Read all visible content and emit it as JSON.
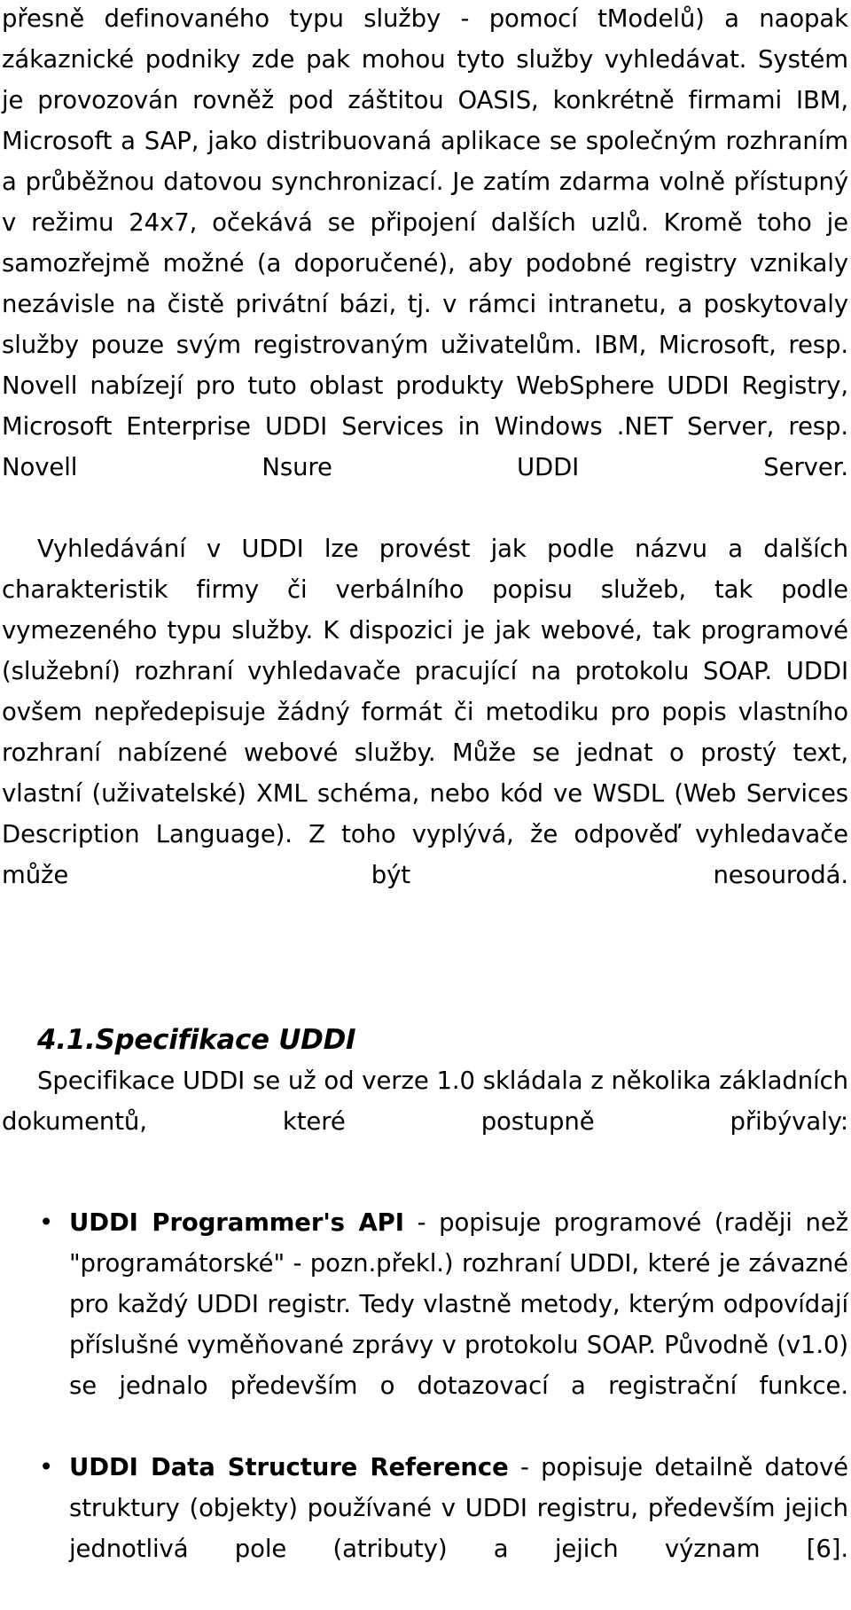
{
  "document": {
    "language": "cs",
    "paragraphs": [
      {
        "id": "p1",
        "text": "přesně definovaného typu služby - pomocí tModelů) a naopak zákaznické podniky zde pak mohou tyto služby vyhledávat. Systém je provozován rovněž pod záštitou OASIS, konkrétně firmami IBM, Microsoft a SAP, jako distribuovaná aplikace se společným rozhraním a průběžnou datovou synchronizací. Je zatím zdarma volně přístupný v režimu 24x7, očekává se připojení dalších uzlů. Kromě toho je samozřejmě možné (a doporučené), aby podobné registry vznikaly nezávisle na čistě privátní bázi, tj. v rámci intranetu, a poskytovaly služby pouze svým registrovaným uživatelům. IBM, Microsoft, resp. Novell nabízejí pro tuto oblast produkty WebSphere UDDI Registry, Microsoft Enterprise UDDI Services in Windows .NET Server, resp. Novell Nsure UDDI Server."
      },
      {
        "id": "p2",
        "text": "Vyhledávání v UDDI lze provést jak podle názvu a dalších charakteristik firmy či verbálního popisu služeb, tak podle vymezeného typu služby. K dispozici je jak webové, tak programové (služební) rozhraní vyhledavače pracující na protokolu SOAP. UDDI ovšem nepředepisuje žádný formát či metodiku pro popis vlastního rozhraní nabízené webové služby. Může se jednat o prostý text, vlastní (uživatelské) XML schéma, nebo kód ve WSDL (Web Services Description Language). Z toho vyplývá, že odpověď vyhledavače může být nesourodá."
      }
    ],
    "heading": {
      "number": "4.1.",
      "title": "Specifikace UDDI",
      "full": "4.1.Specifikace UDDI"
    },
    "section_intro": {
      "id": "p3",
      "text": "Specifikace UDDI se už od verze 1.0 skládala z několika základních dokumentů, které postupně přibývaly:"
    },
    "bullets": {
      "marker": "•",
      "items": [
        {
          "term": "UDDI Programmer's API",
          "rest": " - popisuje programové (raději než \"programátorské\" - pozn.překl.) rozhraní UDDI, které je závazné pro každý UDDI registr. Tedy vlastně metody, kterým odpovídají příslušné vyměňované zprávy v protokolu SOAP. Původně (v1.0) se jednalo především o dotazovací a registrační funkce."
        },
        {
          "term": "UDDI Data Structure Reference",
          "rest": " - popisuje detailně datové struktury (objekty) používané v UDDI registru, především jejich jednotlivá pole (atributy) a jejich význam [6]."
        }
      ]
    }
  }
}
